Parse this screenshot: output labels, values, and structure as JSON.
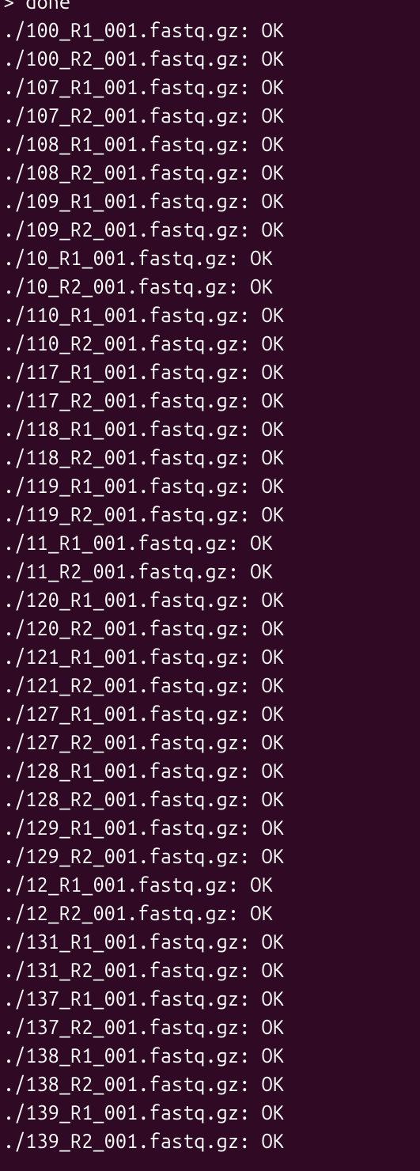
{
  "terminal": {
    "prompt_line": "> done",
    "results": [
      {
        "file": "./100_R1_001.fastq.gz",
        "status": "OK"
      },
      {
        "file": "./100_R2_001.fastq.gz",
        "status": "OK"
      },
      {
        "file": "./107_R1_001.fastq.gz",
        "status": "OK"
      },
      {
        "file": "./107_R2_001.fastq.gz",
        "status": "OK"
      },
      {
        "file": "./108_R1_001.fastq.gz",
        "status": "OK"
      },
      {
        "file": "./108_R2_001.fastq.gz",
        "status": "OK"
      },
      {
        "file": "./109_R1_001.fastq.gz",
        "status": "OK"
      },
      {
        "file": "./109_R2_001.fastq.gz",
        "status": "OK"
      },
      {
        "file": "./10_R1_001.fastq.gz",
        "status": "OK"
      },
      {
        "file": "./10_R2_001.fastq.gz",
        "status": "OK"
      },
      {
        "file": "./110_R1_001.fastq.gz",
        "status": "OK"
      },
      {
        "file": "./110_R2_001.fastq.gz",
        "status": "OK"
      },
      {
        "file": "./117_R1_001.fastq.gz",
        "status": "OK"
      },
      {
        "file": "./117_R2_001.fastq.gz",
        "status": "OK"
      },
      {
        "file": "./118_R1_001.fastq.gz",
        "status": "OK"
      },
      {
        "file": "./118_R2_001.fastq.gz",
        "status": "OK"
      },
      {
        "file": "./119_R1_001.fastq.gz",
        "status": "OK"
      },
      {
        "file": "./119_R2_001.fastq.gz",
        "status": "OK"
      },
      {
        "file": "./11_R1_001.fastq.gz",
        "status": "OK"
      },
      {
        "file": "./11_R2_001.fastq.gz",
        "status": "OK"
      },
      {
        "file": "./120_R1_001.fastq.gz",
        "status": "OK"
      },
      {
        "file": "./120_R2_001.fastq.gz",
        "status": "OK"
      },
      {
        "file": "./121_R1_001.fastq.gz",
        "status": "OK"
      },
      {
        "file": "./121_R2_001.fastq.gz",
        "status": "OK"
      },
      {
        "file": "./127_R1_001.fastq.gz",
        "status": "OK"
      },
      {
        "file": "./127_R2_001.fastq.gz",
        "status": "OK"
      },
      {
        "file": "./128_R1_001.fastq.gz",
        "status": "OK"
      },
      {
        "file": "./128_R2_001.fastq.gz",
        "status": "OK"
      },
      {
        "file": "./129_R1_001.fastq.gz",
        "status": "OK"
      },
      {
        "file": "./129_R2_001.fastq.gz",
        "status": "OK"
      },
      {
        "file": "./12_R1_001.fastq.gz",
        "status": "OK"
      },
      {
        "file": "./12_R2_001.fastq.gz",
        "status": "OK"
      },
      {
        "file": "./131_R1_001.fastq.gz",
        "status": "OK"
      },
      {
        "file": "./131_R2_001.fastq.gz",
        "status": "OK"
      },
      {
        "file": "./137_R1_001.fastq.gz",
        "status": "OK"
      },
      {
        "file": "./137_R2_001.fastq.gz",
        "status": "OK"
      },
      {
        "file": "./138_R1_001.fastq.gz",
        "status": "OK"
      },
      {
        "file": "./138_R2_001.fastq.gz",
        "status": "OK"
      },
      {
        "file": "./139_R1_001.fastq.gz",
        "status": "OK"
      },
      {
        "file": "./139_R2_001.fastq.gz",
        "status": "OK"
      }
    ]
  }
}
